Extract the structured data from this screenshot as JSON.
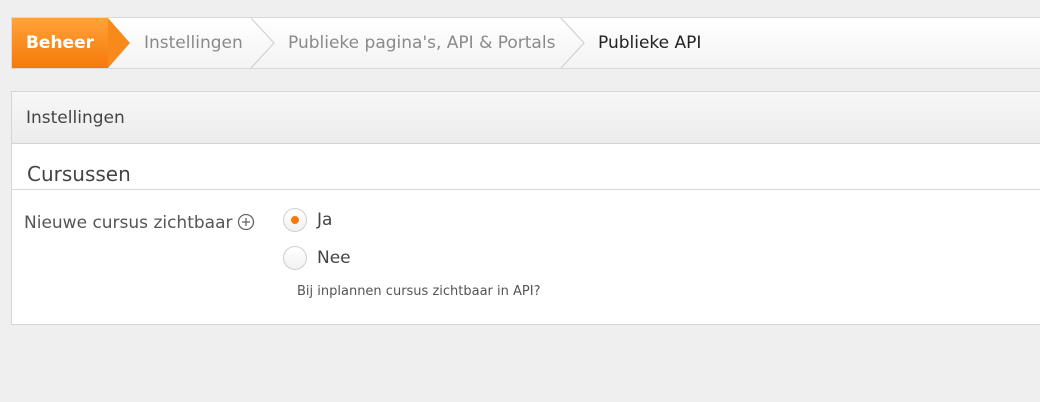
{
  "breadcrumb": {
    "items": [
      {
        "label": "Beheer"
      },
      {
        "label": "Instellingen"
      },
      {
        "label": "Publieke pagina's, API & Portals"
      },
      {
        "label": "Publieke API"
      }
    ]
  },
  "panel": {
    "header": "Instellingen",
    "section_title": "Cursussen",
    "field": {
      "label": "Nieuwe cursus zichtbaar",
      "help_icon": "plus-circle-icon",
      "options": [
        {
          "label": "Ja",
          "selected": true
        },
        {
          "label": "Nee",
          "selected": false
        }
      ],
      "hint": "Bij inplannen cursus zichtbaar in API?"
    }
  },
  "colors": {
    "accent": "#f57a0a",
    "background": "#efefef"
  }
}
